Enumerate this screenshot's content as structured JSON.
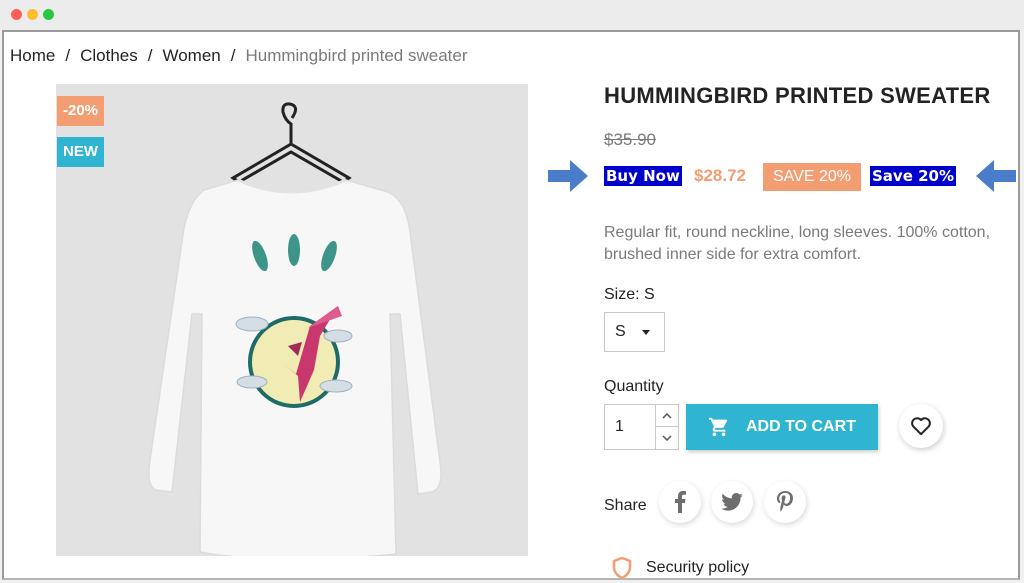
{
  "window": {
    "controls": [
      "close",
      "minimize",
      "maximize"
    ]
  },
  "breadcrumb": {
    "items": [
      "Home",
      "Clothes",
      "Women"
    ],
    "separator": "/",
    "current": "Hummingbird printed sweater"
  },
  "product": {
    "title": "HUMMINGBIRD PRINTED SWEATER",
    "old_price": "$35.90",
    "buy_now_label": "Buy Now",
    "price": "$28.72",
    "save_tag": "SAVE 20%",
    "save_highlight": "Save 20%",
    "badges": {
      "discount": "-20%",
      "new": "NEW"
    },
    "description": "Regular fit, round neckline, long sleeves. 100% cotton, brushed inner side for extra comfort.",
    "image_icon": "hummingbird-sweater-image"
  },
  "size": {
    "label": "Size: S",
    "selected": "S"
  },
  "quantity": {
    "label": "Quantity",
    "value": "1"
  },
  "cart": {
    "add_label": "ADD TO CART",
    "icon": "cart-icon"
  },
  "share": {
    "label": "Share",
    "networks": [
      "facebook-icon",
      "twitter-icon",
      "pinterest-icon"
    ]
  },
  "security": {
    "label": "Security policy",
    "icon": "shield-icon"
  },
  "colors": {
    "accent": "#2fb5d2",
    "sale": "#f39d72",
    "highlight": "#0000cc",
    "arrow": "#4a7cc9"
  }
}
